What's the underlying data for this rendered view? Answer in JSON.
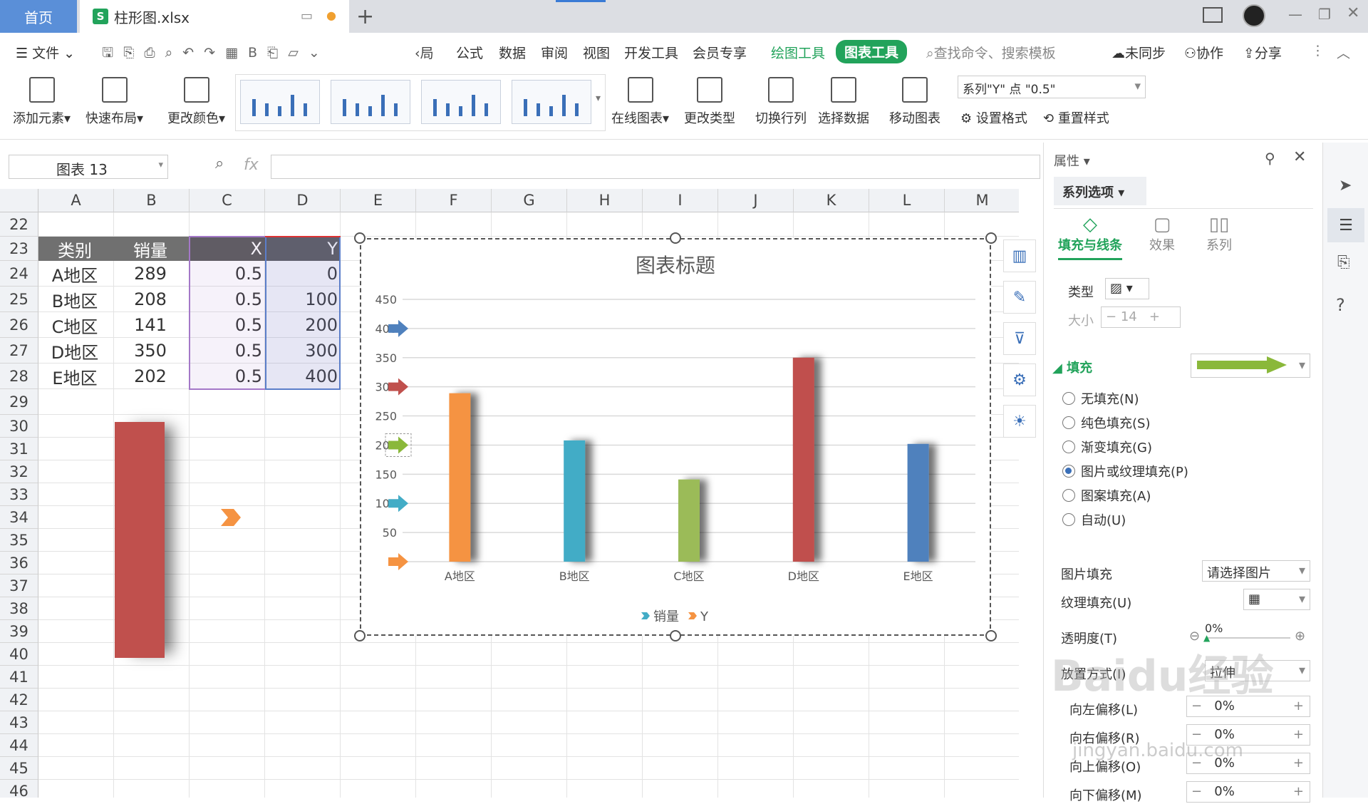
{
  "tabs": {
    "home": "首页",
    "file": "柱形图.xlsx"
  },
  "menu": {
    "file": "文件",
    "items": [
      "公式",
      "数据",
      "审阅",
      "视图",
      "开发工具",
      "会员专享"
    ],
    "draw_tools": "绘图工具",
    "chart_tools": "图表工具",
    "search": "查找命令、搜索模板",
    "sync": "未同步",
    "collab": "协作",
    "share": "分享",
    "prev_tab": "局"
  },
  "ribbon": {
    "add_element": "添加元素",
    "quick_layout": "快速布局",
    "change_color": "更改颜色",
    "online_chart": "在线图表",
    "change_type": "更改类型",
    "switch_rowcol": "切换行列",
    "select_data": "选择数据",
    "move_chart": "移动图表",
    "series_select": "系列\"Y\" 点 \"0.5\"",
    "set_format": "设置格式",
    "reset_style": "重置样式"
  },
  "namebox": "图表 13",
  "fx": "fx",
  "columns": [
    "A",
    "B",
    "C",
    "D",
    "E",
    "F",
    "G",
    "H",
    "I",
    "J",
    "K",
    "L",
    "M"
  ],
  "rows": [
    "22",
    "23",
    "24",
    "25",
    "26",
    "27",
    "28",
    "29",
    "30",
    "31",
    "32",
    "33",
    "34",
    "35",
    "36",
    "37",
    "38",
    "39",
    "40",
    "41",
    "42",
    "43",
    "44",
    "45",
    "46"
  ],
  "table": {
    "headers": [
      "类别",
      "销量",
      "X",
      "Y"
    ],
    "rows": [
      [
        "A地区",
        "289",
        "0.5",
        "0"
      ],
      [
        "B地区",
        "208",
        "0.5",
        "100"
      ],
      [
        "C地区",
        "141",
        "0.5",
        "200"
      ],
      [
        "D地区",
        "350",
        "0.5",
        "300"
      ],
      [
        "E地区",
        "202",
        "0.5",
        "400"
      ]
    ]
  },
  "chart_data": {
    "type": "bar",
    "title": "图表标题",
    "categories": [
      "A地区",
      "B地区",
      "C地区",
      "D地区",
      "E地区"
    ],
    "series": [
      {
        "name": "销量",
        "values": [
          289,
          208,
          141,
          350,
          202
        ]
      },
      {
        "name": "Y",
        "values": [
          0,
          100,
          200,
          300,
          400
        ]
      }
    ],
    "ylim": [
      0,
      450
    ],
    "yticks": [
      "0",
      "50",
      "100",
      "150",
      "200",
      "250",
      "300",
      "350",
      "400",
      "450"
    ],
    "bar_colors": [
      "#f59342",
      "#43acc6",
      "#9bbb59",
      "#c0504d",
      "#4f81bd"
    ],
    "marker_colors": [
      "#f59342",
      "#43acc6",
      "#8ab83a",
      "#c0504d",
      "#4f81bd"
    ],
    "grid": true,
    "legend": "bottom"
  },
  "panel": {
    "title": "属性",
    "tab": "系列选项",
    "subtabs": [
      "填充与线条",
      "效果",
      "系列"
    ],
    "type_label": "类型",
    "size_label": "大小",
    "size_value": "14",
    "fill_label": "填充",
    "fill_options": [
      "无填充(N)",
      "纯色填充(S)",
      "渐变填充(G)",
      "图片或纹理填充(P)",
      "图案填充(A)",
      "自动(U)"
    ],
    "selected_fill": 3,
    "pic_fill_label": "图片填充",
    "pic_fill_value": "请选择图片",
    "texture_label": "纹理填充(U)",
    "transparency_label": "透明度(T)",
    "transparency_value": "0%",
    "placement_label": "放置方式(I)",
    "placement_value": "拉伸",
    "offsets": [
      {
        "label": "向左偏移(L)",
        "value": "0%"
      },
      {
        "label": "向右偏移(R)",
        "value": "0%"
      },
      {
        "label": "向上偏移(O)",
        "value": "0%"
      },
      {
        "label": "向下偏移(M)",
        "value": "0%"
      }
    ]
  },
  "watermark": {
    "brand": "Baidu经验",
    "url": "jingyan.baidu.com"
  }
}
